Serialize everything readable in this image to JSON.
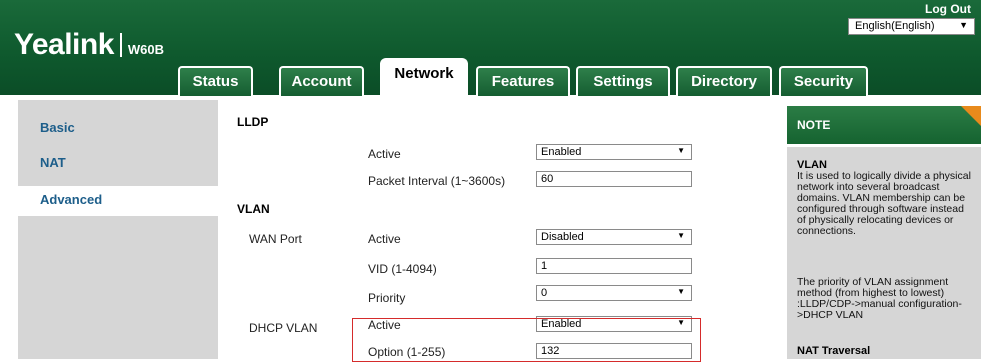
{
  "header": {
    "brand": "Yealink",
    "model": "W60B",
    "logout": "Log Out",
    "language": "English(English)"
  },
  "tabs": [
    {
      "label": "Status"
    },
    {
      "label": "Account"
    },
    {
      "label": "Network",
      "active": true
    },
    {
      "label": "Features"
    },
    {
      "label": "Settings"
    },
    {
      "label": "Directory"
    },
    {
      "label": "Security"
    }
  ],
  "sidebar": {
    "items": [
      {
        "label": "Basic"
      },
      {
        "label": "NAT"
      },
      {
        "label": "Advanced",
        "active": true
      }
    ]
  },
  "lldp": {
    "title": "LLDP",
    "active_label": "Active",
    "active_value": "Enabled",
    "interval_label": "Packet Interval (1~3600s)",
    "interval_value": "60"
  },
  "vlan": {
    "title": "VLAN",
    "wan_port_label": "WAN Port",
    "wan_active_label": "Active",
    "wan_active_value": "Disabled",
    "vid_label": "VID (1-4094)",
    "vid_value": "1",
    "priority_label": "Priority",
    "priority_value": "0",
    "dhcp_label": "DHCP VLAN",
    "dhcp_active_label": "Active",
    "dhcp_active_value": "Enabled",
    "option_label": "Option (1-255)",
    "option_value": "132"
  },
  "note": {
    "title": "NOTE",
    "vlan_heading": "VLAN",
    "vlan_text": "It is used to logically divide a physical network into several broadcast domains. VLAN membership can be configured through software instead of physically relocating devices or connections.",
    "priority_text": "The priority of VLAN assignment method (from highest to lowest) :LLDP/CDP->manual configuration->DHCP VLAN",
    "nat_heading": "NAT Traversal"
  },
  "colors": {
    "header_green": "#0f5a2e",
    "nav_blue": "#1d5e8a",
    "highlight_red": "#d52b2b",
    "note_orange": "#e88a1c"
  }
}
